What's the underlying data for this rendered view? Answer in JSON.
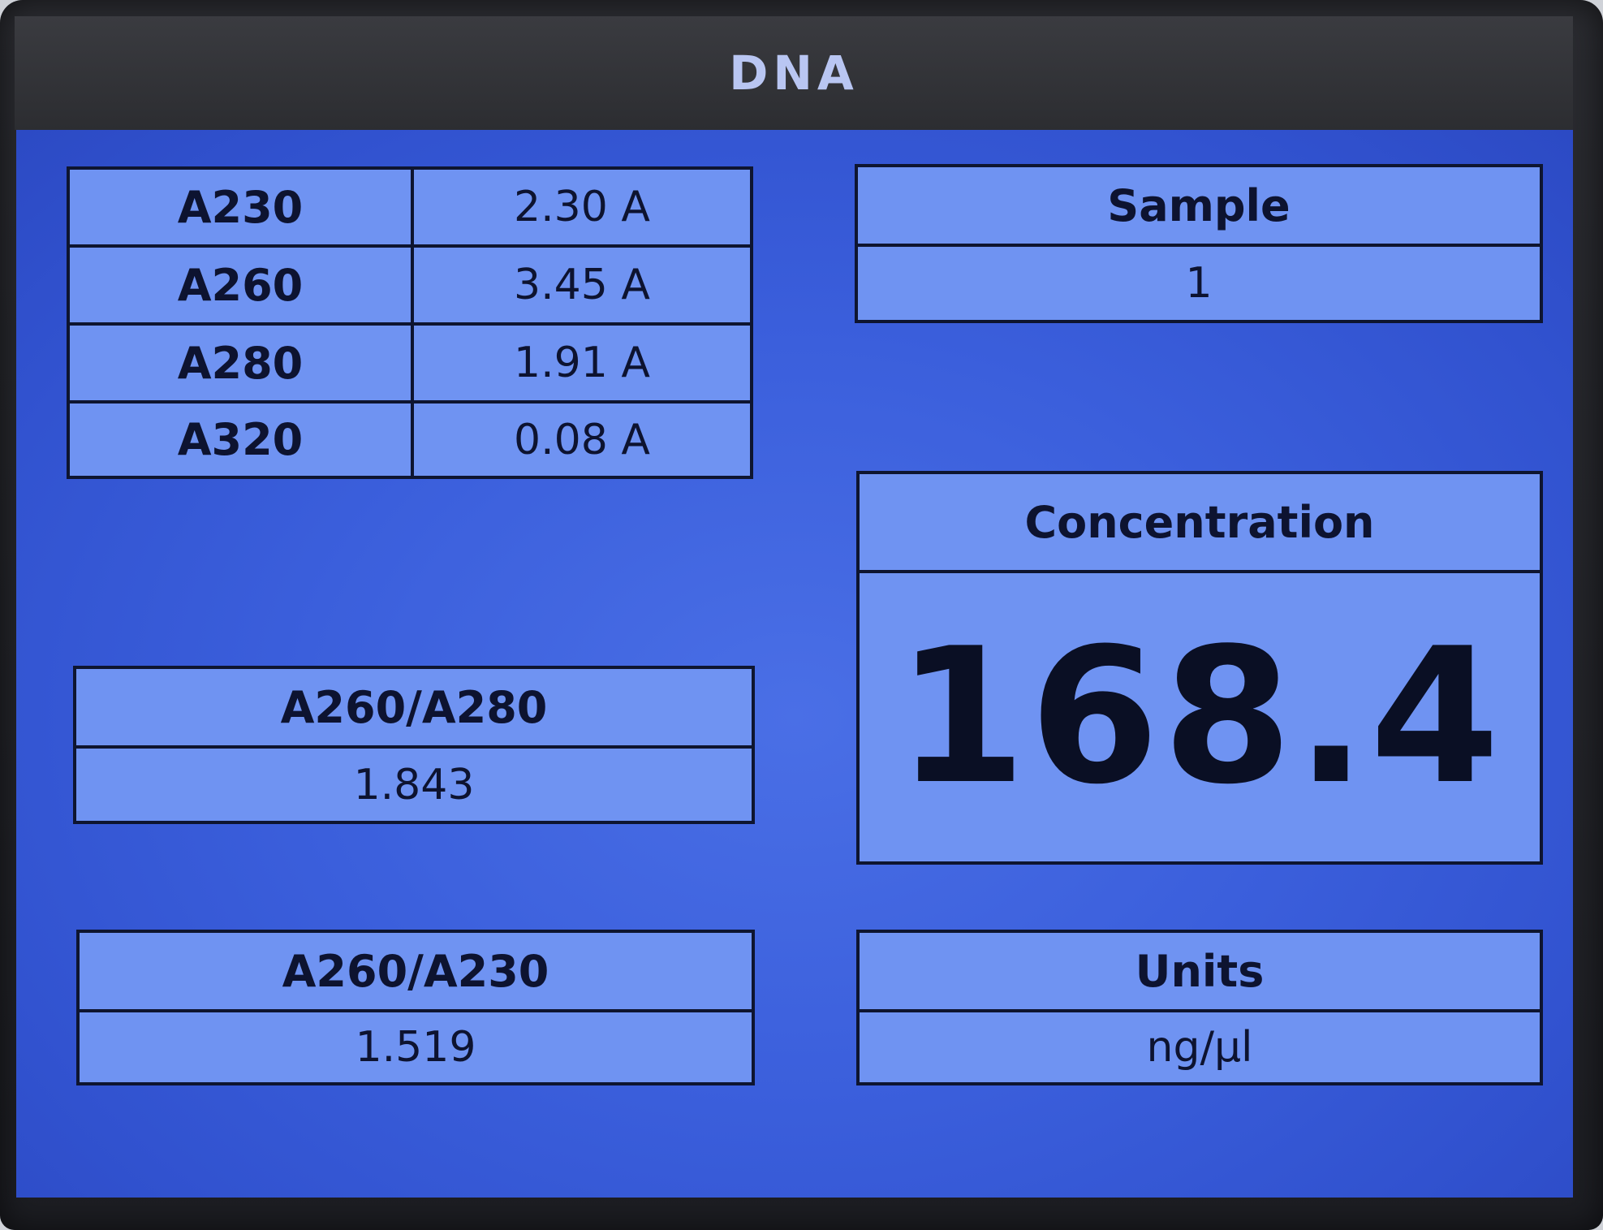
{
  "window": {
    "title": "DNA"
  },
  "absorbance": {
    "rows": [
      {
        "label": "A230",
        "value": "2.30 A"
      },
      {
        "label": "A260",
        "value": "3.45 A"
      },
      {
        "label": "A280",
        "value": "1.91 A"
      },
      {
        "label": "A320",
        "value": "0.08 A"
      }
    ]
  },
  "ratio_260_280": {
    "label": "A260/A280",
    "value": "1.843"
  },
  "ratio_260_230": {
    "label": "A260/A230",
    "value": "1.519"
  },
  "sample": {
    "label": "Sample",
    "value": "1"
  },
  "concentration": {
    "label": "Concentration",
    "value": "168.4"
  },
  "units": {
    "label": "Units",
    "value": "ng/µl"
  },
  "colors": {
    "screen_bg": "#3b5fdc",
    "panel_bg": "#6f93f2",
    "border": "#0e1530",
    "title_text": "#b9c6f2"
  }
}
